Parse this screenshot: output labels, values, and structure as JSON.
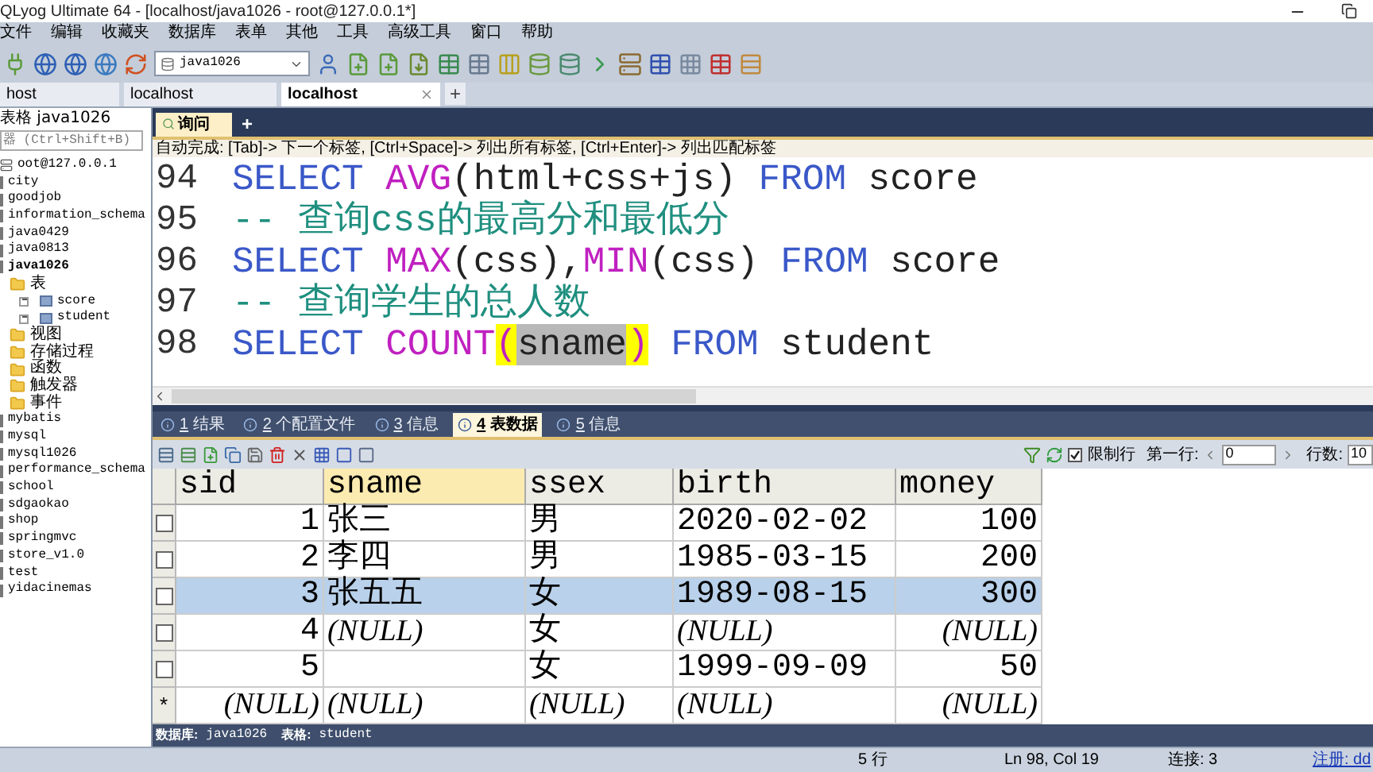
{
  "window": {
    "title": "QLyog Ultimate 64 - [localhost/java1026 - root@127.0.0.1*]"
  },
  "menu": [
    "文件",
    "编辑",
    "收藏夹",
    "数据库",
    "表单",
    "其他",
    "工具",
    "高级工具",
    "窗口",
    "帮助"
  ],
  "toolbar": {
    "database": "java1026"
  },
  "connection_tabs": [
    {
      "label": "host",
      "selected": false
    },
    {
      "label": "localhost",
      "selected": false
    },
    {
      "label": "localhost",
      "selected": true
    }
  ],
  "new_connection": "+",
  "object_browser": {
    "title": "表格 java1026",
    "filter_placeholder": "器 (Ctrl+Shift+B)",
    "tree": [
      {
        "label": "oot@127.0.0.1",
        "kind": "server",
        "children": [
          {
            "label": "city",
            "kind": "database"
          },
          {
            "label": "goodjob",
            "kind": "database"
          },
          {
            "label": "information_schema",
            "kind": "database"
          },
          {
            "label": "java0429",
            "kind": "database"
          },
          {
            "label": "java0813",
            "kind": "database"
          },
          {
            "label": "java1026",
            "kind": "current",
            "children": [
              {
                "label": "表",
                "kind": "folder",
                "children": [
                  {
                    "label": "score",
                    "kind": "table",
                    "expanded": false
                  },
                  {
                    "label": "student",
                    "kind": "table",
                    "expanded": false
                  }
                ]
              },
              {
                "label": "视图",
                "kind": "folder"
              },
              {
                "label": "存储过程",
                "kind": "folder"
              },
              {
                "label": "函数",
                "kind": "folder"
              },
              {
                "label": "触发器",
                "kind": "folder"
              },
              {
                "label": "事件",
                "kind": "folder"
              }
            ]
          },
          {
            "label": "mybatis",
            "kind": "database"
          },
          {
            "label": "mysql",
            "kind": "database"
          },
          {
            "label": "mysql1026",
            "kind": "database"
          },
          {
            "label": "performance_schema",
            "kind": "database"
          },
          {
            "label": "school",
            "kind": "database"
          },
          {
            "label": "sdgaokao",
            "kind": "database"
          },
          {
            "label": "shop",
            "kind": "database"
          },
          {
            "label": "springmvc",
            "kind": "database"
          },
          {
            "label": "store_v1.0",
            "kind": "database"
          },
          {
            "label": "test",
            "kind": "database"
          },
          {
            "label": "yidacinemas",
            "kind": "database"
          }
        ]
      }
    ]
  },
  "query_tabs": [
    {
      "label": "询问",
      "selected": true
    }
  ],
  "new_query": "+",
  "hint": "自动完成: [Tab]-> 下一个标签, [Ctrl+Space]-> 列出所有标签, [Ctrl+Enter]-> 列出匹配标签",
  "editor": [
    {
      "number": "94",
      "tokens": [
        {
          "text": "SELECT ",
          "kind": "keyword"
        },
        {
          "text": "AVG",
          "kind": "function"
        },
        {
          "text": "(html+css+js) ",
          "kind": "plain"
        },
        {
          "text": "FROM",
          "kind": "keyword"
        },
        {
          "text": " score",
          "kind": "plain"
        }
      ]
    },
    {
      "number": "95",
      "tokens": [
        {
          "text": "-- 查询css的最高分和最低分",
          "kind": "comment"
        }
      ]
    },
    {
      "number": "96",
      "tokens": [
        {
          "text": "SELECT ",
          "kind": "keyword"
        },
        {
          "text": "MAX",
          "kind": "function"
        },
        {
          "text": "(css),",
          "kind": "plain"
        },
        {
          "text": "MIN",
          "kind": "function"
        },
        {
          "text": "(css) ",
          "kind": "plain"
        },
        {
          "text": "FROM",
          "kind": "keyword"
        },
        {
          "text": " score",
          "kind": "plain"
        }
      ]
    },
    {
      "number": "97",
      "tokens": [
        {
          "text": "-- 查询学生的总人数",
          "kind": "comment"
        }
      ]
    },
    {
      "number": "98",
      "tokens": [
        {
          "text": "SELECT ",
          "kind": "keyword"
        },
        {
          "text": "COUNT",
          "kind": "function"
        },
        {
          "text": "(",
          "kind": "match"
        },
        {
          "text": "sname",
          "kind": "selected"
        },
        {
          "text": ")",
          "kind": "match"
        },
        {
          "text": " FROM",
          "kind": "keyword"
        },
        {
          "text": " student",
          "kind": "plain"
        }
      ]
    }
  ],
  "result_tabs": [
    {
      "number": "1",
      "label": "结果",
      "selected": false
    },
    {
      "number": "2",
      "label": "个配置文件",
      "selected": false
    },
    {
      "number": "3",
      "label": "信息",
      "selected": false
    },
    {
      "number": "4",
      "label": "表数据",
      "selected": true
    },
    {
      "number": "5",
      "label": "信息",
      "selected": false
    }
  ],
  "grid_toolbar": {
    "limit": {
      "label": "限制行",
      "checked": true
    },
    "first_row_label": "第一行:",
    "first_row": "0",
    "rows_label": "行数:",
    "rows": "10"
  },
  "grid": {
    "columns": [
      {
        "label": "sid",
        "kind": "number",
        "selected": false
      },
      {
        "label": "sname",
        "kind": "text",
        "selected": true
      },
      {
        "label": "ssex",
        "kind": "text",
        "selected": false
      },
      {
        "label": "birth",
        "kind": "text",
        "selected": false
      },
      {
        "label": "money",
        "kind": "number",
        "selected": false
      }
    ],
    "rows": [
      {
        "kind": "data",
        "selected": false,
        "cells": [
          {
            "text": "1",
            "kind": "value"
          },
          {
            "text": "张三",
            "kind": "value"
          },
          {
            "text": "男",
            "kind": "value"
          },
          {
            "text": "2020-02-02",
            "kind": "value"
          },
          {
            "text": "100",
            "kind": "value"
          }
        ]
      },
      {
        "kind": "data",
        "selected": false,
        "cells": [
          {
            "text": "2",
            "kind": "value"
          },
          {
            "text": "李四",
            "kind": "value"
          },
          {
            "text": "男",
            "kind": "value"
          },
          {
            "text": "1985-03-15",
            "kind": "value"
          },
          {
            "text": "200",
            "kind": "value"
          }
        ]
      },
      {
        "kind": "data",
        "selected": true,
        "cells": [
          {
            "text": "3",
            "kind": "value"
          },
          {
            "text": "张五五",
            "kind": "value"
          },
          {
            "text": "女",
            "kind": "value"
          },
          {
            "text": "1989-08-15",
            "kind": "value"
          },
          {
            "text": "300",
            "kind": "value"
          }
        ]
      },
      {
        "kind": "data",
        "selected": false,
        "cells": [
          {
            "text": "4",
            "kind": "value"
          },
          {
            "text": "(NULL)",
            "kind": "null"
          },
          {
            "text": "女",
            "kind": "value"
          },
          {
            "text": "(NULL)",
            "kind": "null"
          },
          {
            "text": "(NULL)",
            "kind": "null"
          }
        ]
      },
      {
        "kind": "data",
        "selected": false,
        "cells": [
          {
            "text": "5",
            "kind": "value"
          },
          {
            "kind": "empty"
          },
          {
            "text": "女",
            "kind": "value"
          },
          {
            "text": "1999-09-09",
            "kind": "value"
          },
          {
            "text": "50",
            "kind": "value"
          }
        ]
      },
      {
        "kind": "new",
        "marker": "*",
        "selected": false,
        "cells": [
          {
            "text": "(NULL)",
            "kind": "null"
          },
          {
            "text": "(NULL)",
            "kind": "null"
          },
          {
            "text": "(NULL)",
            "kind": "null"
          },
          {
            "text": "(NULL)",
            "kind": "null"
          },
          {
            "text": "(NULL)",
            "kind": "null"
          }
        ]
      }
    ]
  },
  "info_bar": {
    "database_label": "数据库:",
    "database": "java1026",
    "table_label": "表格:",
    "table": "student"
  },
  "status_bar": [
    {
      "text": "5 行",
      "kind": "text"
    },
    {
      "text": "Ln 98, Col 19",
      "kind": "text"
    },
    {
      "text": "连接: 3",
      "kind": "text"
    },
    {
      "text": "注册: dd",
      "kind": "link"
    }
  ]
}
